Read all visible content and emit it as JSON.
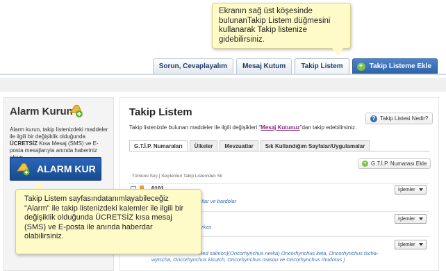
{
  "colors": {
    "tooltip_bg": "#fffbc8",
    "accent_blue": "#2f63a8",
    "link_purple": "#8a2b7a",
    "green_plus": "#7cc24a"
  },
  "tooltip_top": {
    "text": "Ekranın sağ üst köşesinde bulunanTakip Listem düğmesini kullanarak Takip listenize gidebilirsiniz."
  },
  "tabs": [
    {
      "label": "Sorun, Cevaplayalım"
    },
    {
      "label": "Mesaj Kutum"
    },
    {
      "label": "Takip Listem"
    },
    {
      "label": "Takip Listeme Ekle",
      "icon": "plus-circle-icon"
    }
  ],
  "left": {
    "title": "Alarm Kurun",
    "description_pre": "Alarm kurun, takip listenizdeki maddeler ile ilgili bir değişiklik olduğunda ",
    "description_bold": "ÜCRETSİZ",
    "description_post": " Kısa Mesaj (SMS) ve E-posta mesajlarıyla anında haberiniz olsun",
    "button_label": "ALARM KUR"
  },
  "main": {
    "title": "Takip Listem",
    "help_label": "Takip Listesi Nedir?",
    "desc_pre": "Takip listenizde bulunan maddeler ile ilgili değişikleri \"",
    "desc_link": "Mesaj Kutunuz",
    "desc_post": "\"dan takip edebilirsiniz.",
    "subtabs": [
      "G.T.İ.P. Numaraları",
      "Ülkeler",
      "Mevzuatlar",
      "Sık Kullandığım Sayfalar/Uygulamalar"
    ],
    "add_gtip_label": "G.T.İ.P. Numarası Ekle",
    "select_line": "Tümünü Seç | Seçilenleri Takip Listemden Sil",
    "rows": [
      {
        "code": "0101",
        "text": "atlar ve bardolar",
        "action": "İşlemler"
      },
      {
        "code": "",
        "text": "arkas",
        "action": "İşlemler"
      },
      {
        "code": "",
        "text": "Red salmon)(Oncorhynchus nerka) Oncorhynchus keta, Oncorhynchus tscha-",
        "text2": "wytscha, Oncorhynchus kisutch, Oncorhynchus masou ve Oncorhynchus rhodorus )",
        "action": "İşlemler"
      }
    ]
  },
  "tooltip_bottom": {
    "text": "Takip Listem sayfasındatanımlayabileceğiz \"Alarm\" ile takip listenizdeki kalemler ile ilgili bir değişiklik olduğunda ÜCRETSİZ kısa mesaj (SMS) ve E-posta ile anında haberdar olabilirsiniz."
  }
}
